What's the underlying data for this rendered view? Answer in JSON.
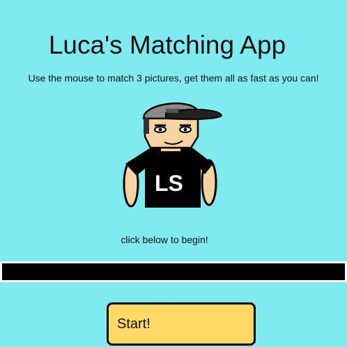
{
  "header": {
    "title": "Luca's Matching App",
    "subtitle": "Use the mouse to match 3 pictures, get them all as fast as you can!"
  },
  "avatar": {
    "icon": "cartoon-boy-icon",
    "shirt_logo": "LS"
  },
  "hint": "click below to begin!",
  "start_button": {
    "label": "Start!"
  },
  "colors": {
    "background": "#7feaf0",
    "button": "#ffd966",
    "divider": "#000000"
  }
}
